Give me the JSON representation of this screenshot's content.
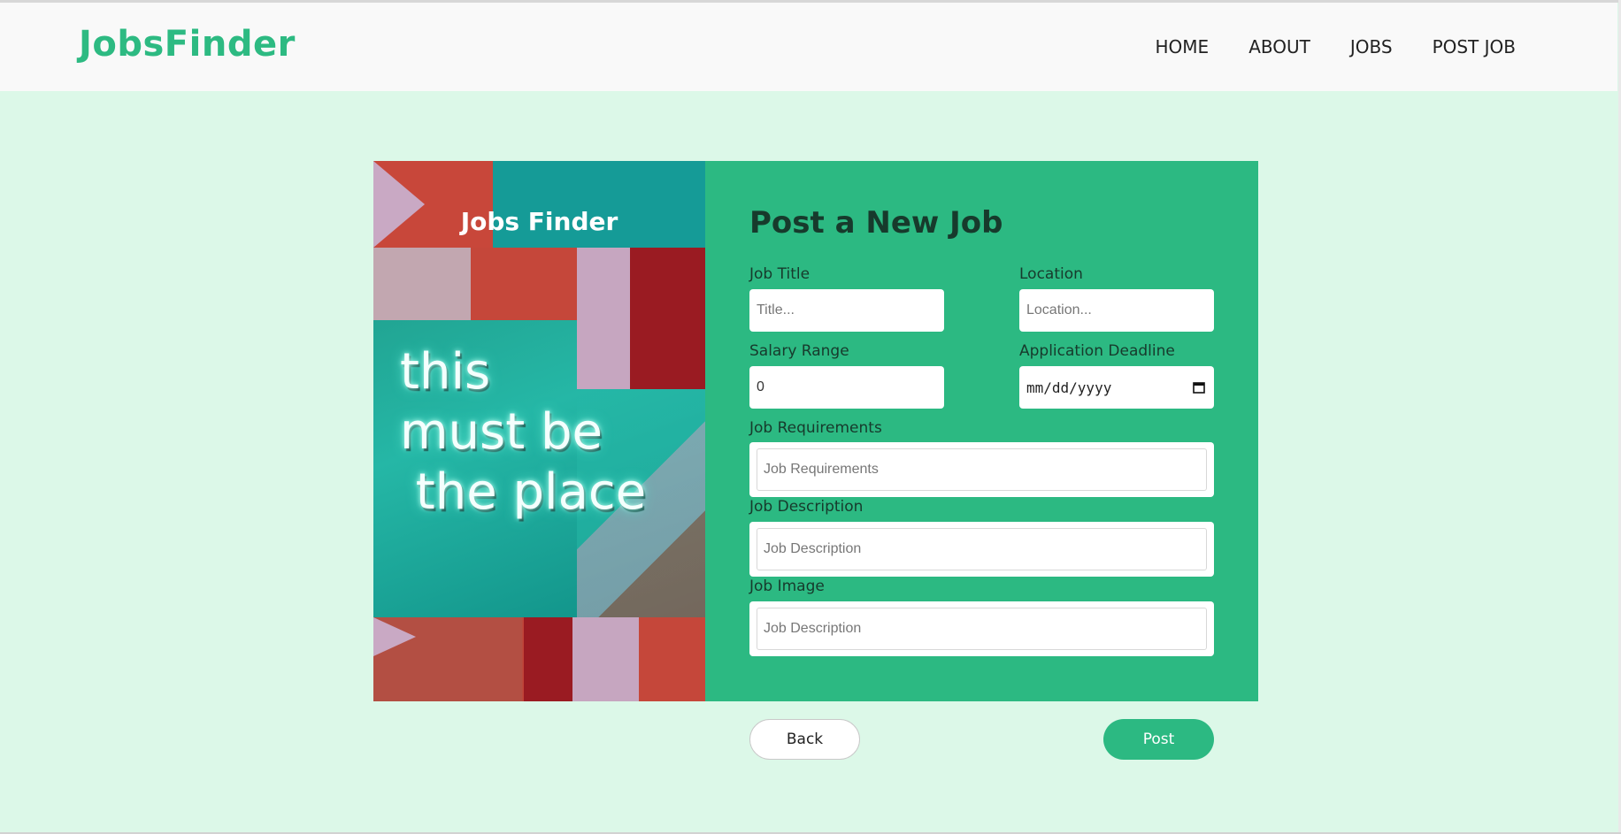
{
  "header": {
    "brand": "JobsFinder",
    "nav": [
      "HOME",
      "ABOUT",
      "JOBS",
      "POST JOB"
    ]
  },
  "poster": {
    "title": "Jobs Finder",
    "neon_lines": "this\nmust be\n the place"
  },
  "form": {
    "title": "Post a New Job",
    "job_title": {
      "label": "Job Title",
      "placeholder": "Title..."
    },
    "location": {
      "label": "Location",
      "placeholder": "Location..."
    },
    "salary": {
      "label": "Salary Range",
      "value": "0"
    },
    "deadline": {
      "label": "Application Deadline",
      "value": "mm/dd/yyyy"
    },
    "requirements": {
      "label": "Job Requirements",
      "placeholder": "Job Requirements"
    },
    "description": {
      "label": "Job Description",
      "placeholder": "Job Description"
    },
    "image": {
      "label": "Job Image",
      "placeholder": "Job Description"
    }
  },
  "buttons": {
    "back": "Back",
    "post": "Post"
  },
  "colors": {
    "accent": "#2cb982",
    "background": "#dcf8e8",
    "header": "#f9f9f9",
    "text_dark": "#173a2c"
  },
  "icons": {
    "deadline": "calendar-icon"
  }
}
